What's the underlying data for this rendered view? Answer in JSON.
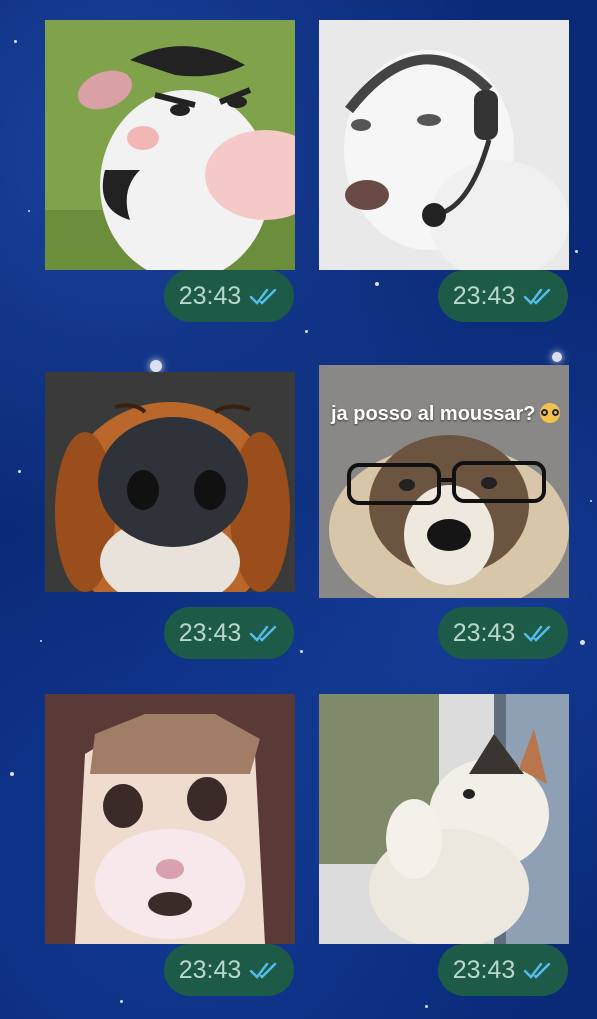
{
  "messages": [
    {
      "sticker_icon": "cow-sticker-icon",
      "time": "23:43",
      "status": "read-receipt-icon"
    },
    {
      "sticker_icon": "dog-headset-sticker-icon",
      "time": "23:43",
      "status": "read-receipt-icon"
    },
    {
      "sticker_icon": "dog-nose-sticker-icon",
      "time": "23:43",
      "status": "read-receipt-icon"
    },
    {
      "sticker_icon": "dog-glasses-sticker-icon",
      "caption": "ja posso al moussar?",
      "time": "23:43",
      "status": "read-receipt-icon"
    },
    {
      "sticker_icon": "cat-face-sticker-icon",
      "time": "23:43",
      "status": "read-receipt-icon"
    },
    {
      "sticker_icon": "cat-window-sticker-icon",
      "time": "23:43",
      "status": "read-receipt-icon"
    }
  ],
  "colors": {
    "bubble": "#1e5a48",
    "time_text": "#b9d7cc",
    "tick": "#53bdeb",
    "background": "#0a2a78"
  }
}
